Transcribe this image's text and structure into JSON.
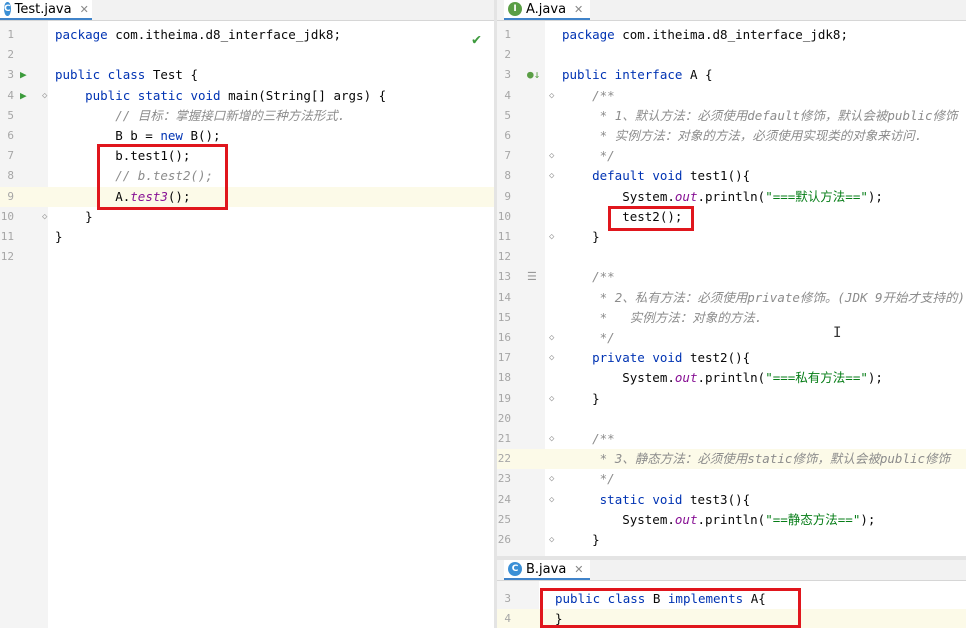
{
  "left_editor": {
    "tab": {
      "icon": "C",
      "label": "Test.java"
    },
    "lines": [
      {
        "n": "1",
        "segs": [
          [
            "kw",
            "package "
          ],
          [
            "t",
            "com.itheima.d8_interface_jdk8;"
          ]
        ]
      },
      {
        "n": "2",
        "segs": []
      },
      {
        "n": "3",
        "run": true,
        "segs": [
          [
            "kw",
            "public class "
          ],
          [
            "t",
            "Test {"
          ]
        ]
      },
      {
        "n": "4",
        "run": true,
        "segs": [
          [
            "t",
            "    "
          ],
          [
            "kw",
            "public static void "
          ],
          [
            "t",
            "main(String[] args) {"
          ]
        ]
      },
      {
        "n": "5",
        "segs": [
          [
            "t",
            "        "
          ],
          [
            "cm",
            "// 目标：掌握接口新增的三种方法形式."
          ]
        ]
      },
      {
        "n": "6",
        "segs": [
          [
            "t",
            "        B b = "
          ],
          [
            "kw",
            "new "
          ],
          [
            "t",
            "B();"
          ]
        ]
      },
      {
        "n": "7",
        "segs": [
          [
            "t",
            "        b.test1();"
          ]
        ]
      },
      {
        "n": "8",
        "segs": [
          [
            "t",
            "        "
          ],
          [
            "cm",
            "// b.test2();"
          ]
        ]
      },
      {
        "n": "9",
        "hl": true,
        "segs": [
          [
            "t",
            "        A."
          ],
          [
            "fld",
            "test3"
          ],
          [
            "t",
            "();"
          ]
        ]
      },
      {
        "n": "10",
        "segs": [
          [
            "t",
            "    }"
          ]
        ]
      },
      {
        "n": "11",
        "segs": [
          [
            "t",
            "}"
          ]
        ]
      },
      {
        "n": "12",
        "segs": []
      }
    ]
  },
  "right_editor": {
    "tab": {
      "icon": "I",
      "label": "A.java"
    },
    "lines": [
      {
        "n": "1",
        "segs": [
          [
            "kw",
            "package "
          ],
          [
            "t",
            "com.itheima.d8_interface_jdk8;"
          ]
        ]
      },
      {
        "n": "2",
        "segs": []
      },
      {
        "n": "3",
        "segs": [
          [
            "kw",
            "public interface "
          ],
          [
            "t",
            "A {"
          ]
        ]
      },
      {
        "n": "4",
        "segs": [
          [
            "t",
            "    "
          ],
          [
            "cm",
            "/**"
          ]
        ]
      },
      {
        "n": "5",
        "segs": [
          [
            "t",
            "     "
          ],
          [
            "cm",
            "* 1、默认方法：必须使用default修饰，默认会被public修饰"
          ]
        ]
      },
      {
        "n": "6",
        "segs": [
          [
            "t",
            "     "
          ],
          [
            "cm",
            "* 实例方法：对象的方法，必须使用实现类的对象来访问."
          ]
        ]
      },
      {
        "n": "7",
        "segs": [
          [
            "t",
            "     "
          ],
          [
            "cm",
            "*/"
          ]
        ]
      },
      {
        "n": "8",
        "segs": [
          [
            "t",
            "    "
          ],
          [
            "kw",
            "default void "
          ],
          [
            "t",
            "test1(){"
          ]
        ]
      },
      {
        "n": "9",
        "segs": [
          [
            "t",
            "        System."
          ],
          [
            "fld",
            "out"
          ],
          [
            "t",
            ".println("
          ],
          [
            "st",
            "\"===默认方法==\""
          ],
          [
            "t",
            ");"
          ]
        ]
      },
      {
        "n": "10",
        "segs": [
          [
            "t",
            "        test2();"
          ]
        ]
      },
      {
        "n": "11",
        "segs": [
          [
            "t",
            "    }"
          ]
        ]
      },
      {
        "n": "12",
        "segs": []
      },
      {
        "n": "13",
        "segs": [
          [
            "t",
            "    "
          ],
          [
            "cm",
            "/**"
          ]
        ]
      },
      {
        "n": "14",
        "segs": [
          [
            "t",
            "     "
          ],
          [
            "cm",
            "* 2、私有方法：必须使用private修饰。(JDK 9开始才支持的)"
          ]
        ]
      },
      {
        "n": "15",
        "segs": [
          [
            "t",
            "     "
          ],
          [
            "cm",
            "*   实例方法：对象的方法."
          ]
        ]
      },
      {
        "n": "16",
        "segs": [
          [
            "t",
            "     "
          ],
          [
            "cm",
            "*/"
          ]
        ]
      },
      {
        "n": "17",
        "segs": [
          [
            "t",
            "    "
          ],
          [
            "kw",
            "private void "
          ],
          [
            "t",
            "test2(){"
          ]
        ]
      },
      {
        "n": "18",
        "segs": [
          [
            "t",
            "        System."
          ],
          [
            "fld",
            "out"
          ],
          [
            "t",
            ".println("
          ],
          [
            "st",
            "\"===私有方法==\""
          ],
          [
            "t",
            ");"
          ]
        ]
      },
      {
        "n": "19",
        "segs": [
          [
            "t",
            "    }"
          ]
        ]
      },
      {
        "n": "20",
        "segs": []
      },
      {
        "n": "21",
        "segs": [
          [
            "t",
            "    "
          ],
          [
            "cm",
            "/**"
          ]
        ]
      },
      {
        "n": "22",
        "hl": true,
        "segs": [
          [
            "t",
            "     "
          ],
          [
            "cm",
            "* 3、静态方法：必须使用static修饰，默认会被public修饰"
          ]
        ]
      },
      {
        "n": "23",
        "segs": [
          [
            "t",
            "     "
          ],
          [
            "cm",
            "*/"
          ]
        ]
      },
      {
        "n": "24",
        "segs": [
          [
            "t",
            "     "
          ],
          [
            "kw",
            "static void "
          ],
          [
            "t",
            "test3(){"
          ]
        ]
      },
      {
        "n": "25",
        "segs": [
          [
            "t",
            "        System."
          ],
          [
            "fld",
            "out"
          ],
          [
            "t",
            ".println("
          ],
          [
            "st",
            "\"==静态方法==\""
          ],
          [
            "t",
            ");"
          ]
        ]
      },
      {
        "n": "26",
        "segs": [
          [
            "t",
            "    }"
          ]
        ]
      }
    ]
  },
  "bottom_editor": {
    "tab": {
      "icon": "C",
      "label": "B.java"
    },
    "lines": [
      {
        "n": "3",
        "segs": [
          [
            "kw",
            "public class "
          ],
          [
            "t",
            "B "
          ],
          [
            "kw",
            "implements "
          ],
          [
            "t",
            "A{"
          ]
        ]
      },
      {
        "n": "4",
        "hl": true,
        "segs": [
          [
            "t",
            "}"
          ]
        ]
      }
    ]
  },
  "colors": {
    "keyword": "#0033b3",
    "comment": "#8c8c8c",
    "string": "#067d17",
    "highlight_box": "#e0161d"
  },
  "icons": {
    "run": "run-gutter-icon",
    "implemented": "implemented-gutter-icon",
    "fold": "fold-icon",
    "check": "check-icon",
    "close": "close-icon"
  }
}
